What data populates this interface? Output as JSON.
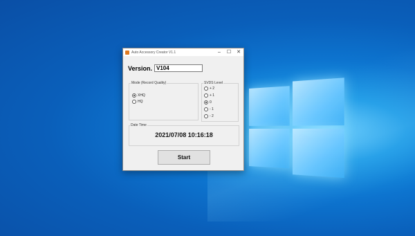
{
  "window": {
    "title": "Auto Accessory Creator V1.1",
    "controls": {
      "minimize": "–",
      "maximize": "☐",
      "close": "✕"
    }
  },
  "version": {
    "label": "Version.",
    "value": "V104"
  },
  "mode_group": {
    "label": "Mode (Record Quality)",
    "options": [
      {
        "label": "XHQ",
        "selected": true
      },
      {
        "label": "HQ",
        "selected": false
      }
    ]
  },
  "svds_group": {
    "label": "SVDS Level",
    "options": [
      {
        "label": "+ 2",
        "selected": false
      },
      {
        "label": "+ 1",
        "selected": false
      },
      {
        "label": "0",
        "selected": true
      },
      {
        "label": "- 1",
        "selected": false
      },
      {
        "label": "- 2",
        "selected": false
      }
    ]
  },
  "date_group": {
    "label": "Date Time",
    "value": "2021/07/08 10:16:18"
  },
  "start_button": {
    "label": "Start"
  },
  "colors": {
    "accent_icon": "#e07a20",
    "desktop": "#0a5fba"
  }
}
